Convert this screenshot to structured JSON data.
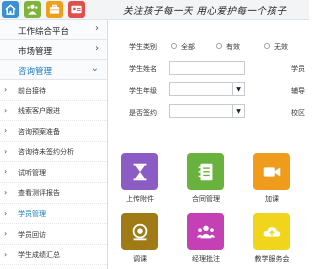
{
  "header": {
    "slogan": "关注孩子每一天  用心爱护每一个孩子",
    "icons": [
      {
        "name": "home-icon",
        "color": "#3d8fd4"
      },
      {
        "name": "users-icon",
        "color": "#7fb33a"
      },
      {
        "name": "briefcase-icon",
        "color": "#f0a018"
      },
      {
        "name": "id-card-icon",
        "color": "#e0504a"
      }
    ]
  },
  "sidebar": {
    "sections": [
      {
        "label": "工作综合平台",
        "arrow": "›"
      },
      {
        "label": "市场管理",
        "arrow": "›"
      },
      {
        "label": "咨询管理",
        "arrow": "⌄"
      }
    ],
    "items": [
      {
        "label": "前台接待"
      },
      {
        "label": "线索客户跟进"
      },
      {
        "label": "咨询预案准备"
      },
      {
        "label": "咨询待未签约分析"
      },
      {
        "label": "试听管理"
      },
      {
        "label": "查看测评报告"
      },
      {
        "label": "学员管理"
      },
      {
        "label": "学员回访"
      },
      {
        "label": "学生成绩汇总"
      }
    ],
    "selected_item": "学员管理",
    "accent_color": "#1a7bc4"
  },
  "form": {
    "category_label": "学生类别",
    "category_options": [
      "全部",
      "有效",
      "无效"
    ],
    "name_label": "学生姓名",
    "name_value": "",
    "grade_label": "学生年级",
    "grade_value": "",
    "signed_label": "是否签约",
    "signed_value": "",
    "right_labels": [
      "学员",
      "辅导",
      "校区"
    ]
  },
  "tiles": [
    {
      "label": "上传附件",
      "icon": "hourglass-icon",
      "color": "#8a5cc4"
    },
    {
      "label": "合同管理",
      "icon": "notebook-icon",
      "color": "#6ab23e"
    },
    {
      "label": "加课",
      "icon": "video-camera-icon",
      "color": "#ef9b1c"
    },
    {
      "label": "调课",
      "icon": "coin-icon",
      "color": "#a07a14"
    },
    {
      "label": "经理批注",
      "icon": "group-icon",
      "color": "#c440b4"
    },
    {
      "label": "教学服务会",
      "icon": "cloud-icon",
      "color": "#f0d51c"
    }
  ]
}
